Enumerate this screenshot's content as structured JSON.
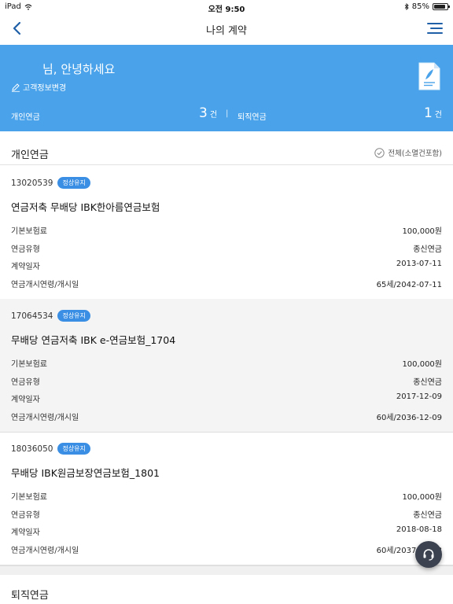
{
  "status_bar": {
    "device": "iPad",
    "time": "오전 9:50",
    "battery": "85%",
    "battery_level": 0.85
  },
  "nav": {
    "title": "나의 계약"
  },
  "hero": {
    "greeting": "님, 안녕하세요",
    "edit_link": "고객정보변경",
    "personal_label": "개인연금",
    "personal_count": "3",
    "personal_unit": "건",
    "separator": "|",
    "retire_label": "퇴직연금",
    "retire_count": "1",
    "retire_unit": "건"
  },
  "section": {
    "title": "개인연금",
    "filter_label": "전체(소멸건포함)"
  },
  "contracts": [
    {
      "number": "13020539",
      "status": "정상유지",
      "product": "연금저축 무배당 IBK한아름연금보험",
      "rows": [
        {
          "label": "기본보험료",
          "value": "100,000원"
        },
        {
          "label": "연금유형",
          "value": "종신연금"
        },
        {
          "label": "계약일자",
          "value": "2013-07-11"
        },
        {
          "label": "연금개시연령/개시일",
          "value": "65세/2042-07-11"
        }
      ]
    },
    {
      "number": "17064534",
      "status": "정상유지",
      "product": "무배당 연금저축 IBK e-연금보험_1704",
      "rows": [
        {
          "label": "기본보험료",
          "value": "100,000원"
        },
        {
          "label": "연금유형",
          "value": "종신연금"
        },
        {
          "label": "계약일자",
          "value": "2017-12-09"
        },
        {
          "label": "연금개시연령/개시일",
          "value": "60세/2036-12-09"
        }
      ]
    },
    {
      "number": "18036050",
      "status": "정상유지",
      "product": "무배당 IBK원금보장연금보험_1801",
      "rows": [
        {
          "label": "기본보험료",
          "value": "100,000원"
        },
        {
          "label": "연금유형",
          "value": "종신연금"
        },
        {
          "label": "계약일자",
          "value": "2018-08-18"
        },
        {
          "label": "연금개시연령/개시일",
          "value": "60세/2037-08-18"
        }
      ]
    }
  ],
  "section2": {
    "title": "퇴직연금"
  },
  "colors": {
    "hero_bg": "#4aa3ea",
    "badge": "#3a8ee3",
    "accent": "#1f5fa8",
    "fab": "#3d4250"
  }
}
